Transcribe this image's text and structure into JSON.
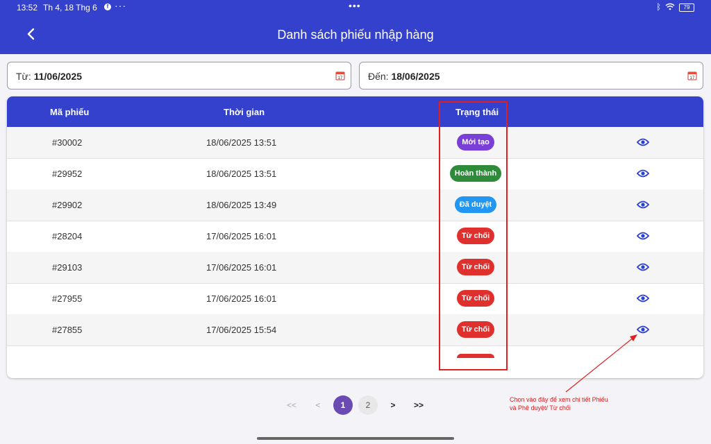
{
  "status_bar": {
    "time": "13:52",
    "date": "Th 4, 18 Thg 6",
    "more": "···",
    "center_dots": "•••",
    "battery": "79"
  },
  "header": {
    "title": "Danh sách phiếu nhập hàng"
  },
  "filters": {
    "from_label": "Từ:",
    "from_value": "11/06/2025",
    "to_label": "Đến:",
    "to_value": "18/06/2025"
  },
  "table": {
    "columns": [
      "Mã phiếu",
      "Thời gian",
      "Trạng thái"
    ],
    "rows": [
      {
        "code": "#30002",
        "time": "18/06/2025 13:51",
        "status": "Mới tạo"
      },
      {
        "code": "#29952",
        "time": "18/06/2025 13:51",
        "status": "Hoàn thành"
      },
      {
        "code": "#29902",
        "time": "18/06/2025 13:49",
        "status": "Đã duyệt"
      },
      {
        "code": "#28204",
        "time": "17/06/2025 16:01",
        "status": "Từ chối"
      },
      {
        "code": "#29103",
        "time": "17/06/2025 16:01",
        "status": "Từ chối"
      },
      {
        "code": "#27955",
        "time": "17/06/2025 16:01",
        "status": "Từ chối"
      },
      {
        "code": "#27855",
        "time": "17/06/2025 15:54",
        "status": "Từ chối"
      }
    ]
  },
  "status_colors": {
    "Mới tạo": "#7a3fd6",
    "Hoàn thành": "#2e8b3a",
    "Đã duyệt": "#2196f3",
    "Từ chối": "#e0302e"
  },
  "pagination": {
    "first": "<<",
    "prev": "<",
    "pages": [
      "1",
      "2"
    ],
    "current": "1",
    "next": ">",
    "last": ">>"
  },
  "annotation": {
    "line1": "Chọn vào đây để xem chi tiết Phiếu",
    "line2": "và Phê duyệt/ Từ chối"
  },
  "colors": {
    "primary": "#3441cc",
    "highlight": "#e02020"
  }
}
